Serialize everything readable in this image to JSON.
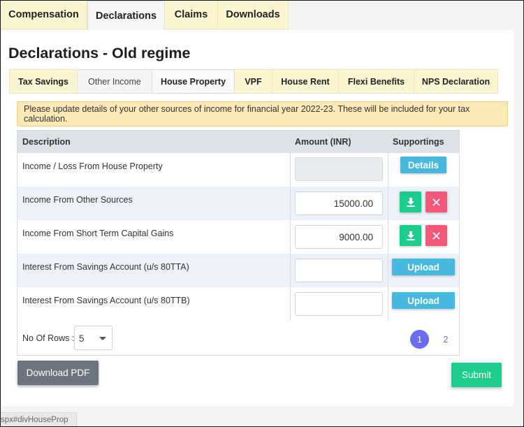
{
  "top_tabs": [
    {
      "label": "Compensation"
    },
    {
      "label": "Declarations"
    },
    {
      "label": "Claims"
    },
    {
      "label": "Downloads"
    }
  ],
  "page_title": "Declarations - Old regime",
  "sub_tabs": [
    {
      "label": "Tax Savings"
    },
    {
      "label": "Other Income"
    },
    {
      "label": "House Property"
    },
    {
      "label": "VPF"
    },
    {
      "label": "House Rent"
    },
    {
      "label": "Flexi Benefits"
    },
    {
      "label": "NPS Declaration"
    }
  ],
  "active_sub_tab": "Other Income",
  "alert_text": "Please update details of your other sources of income for financial year 2022-23. These will be included for your tax calculation.",
  "table": {
    "headers": {
      "description": "Description",
      "amount": "Amount (INR)",
      "supportings": "Supportings"
    },
    "rows": [
      {
        "description": "Income / Loss From House Property",
        "amount": "",
        "action": "Details"
      },
      {
        "description": "Income From Other Sources",
        "amount": "15000.00",
        "action": "download-delete"
      },
      {
        "description": "Income From Short Term Capital Gains",
        "amount": "9000.00",
        "action": "download-delete"
      },
      {
        "description": "Interest From Savings Account (u/s 80TTA)",
        "amount": "",
        "action": "Upload"
      },
      {
        "description": "Interest From Savings Account (u/s 80TTB)",
        "amount": "",
        "action": "Upload"
      }
    ],
    "details_label": "Details",
    "upload_label": "Upload"
  },
  "pagination": {
    "rows_label": "No Of Rows :",
    "rows_value": "5",
    "pages": [
      "1",
      "2"
    ],
    "current_page": "1"
  },
  "download_pdf_label": "Download PDF",
  "submit_label": "Submit",
  "status_bar_text": "spx#divHouseProp",
  "colors": {
    "tab_bg": "#fbf6d2",
    "alert_bg": "#fde9b7",
    "table_header_bg": "#dee1e6",
    "alt_row_bg": "#eef1f7",
    "info_button": "#47b9de",
    "success": "#1dcb8c",
    "danger": "#f6587a",
    "page_active": "#6a6cf2",
    "secondary_button": "#6b747d"
  }
}
